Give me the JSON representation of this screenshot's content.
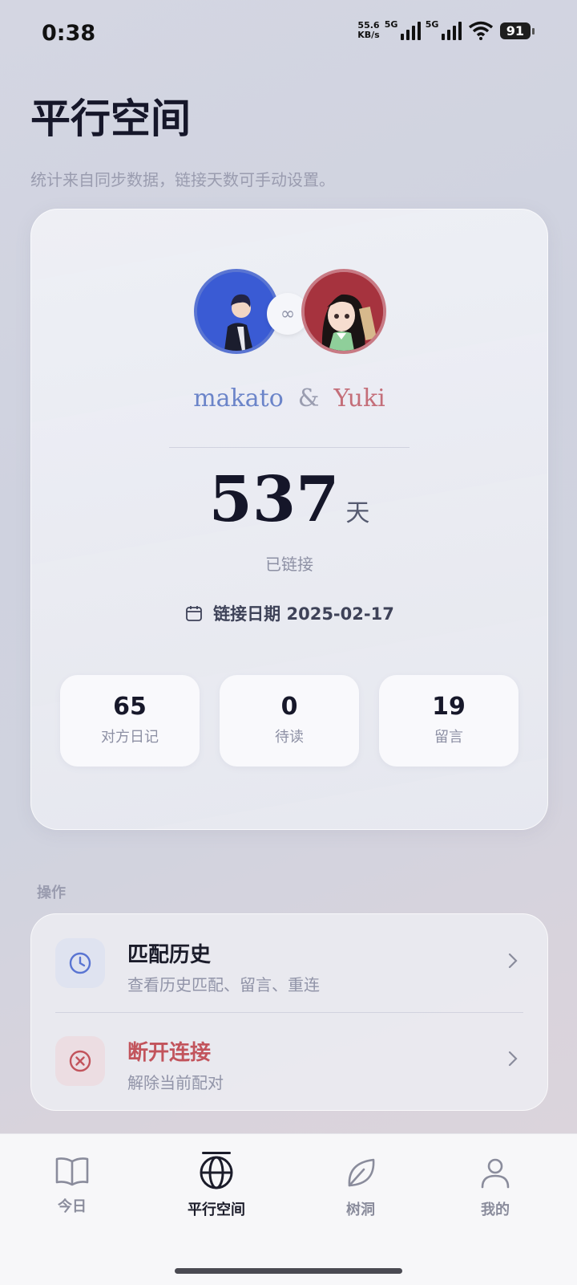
{
  "status_bar": {
    "time": "0:38",
    "net_speed_value": "55.6",
    "net_speed_unit": "KB/s",
    "sim1": "5G",
    "sim2": "5G",
    "battery": "91"
  },
  "page": {
    "title": "平行空间",
    "subtitle": "统计来自同步数据，链接天数可手动设置。"
  },
  "connection": {
    "user_a": "makato",
    "ampersand": "&",
    "user_b": "Yuki",
    "link_symbol": "∞",
    "days": "537",
    "days_unit": "天",
    "linked_label": "已链接",
    "date_label": "链接日期 2025-02-17"
  },
  "stats": [
    {
      "value": "65",
      "label": "对方日记"
    },
    {
      "value": "0",
      "label": "待读"
    },
    {
      "value": "19",
      "label": "留言"
    }
  ],
  "actions": {
    "section_label": "操作",
    "items": [
      {
        "title": "匹配历史",
        "subtitle": "查看历史匹配、留言、重连",
        "icon": "clock-icon",
        "color": "#1b1c2a"
      },
      {
        "title": "断开连接",
        "subtitle": "解除当前配对",
        "icon": "close-circle-icon",
        "color": "#c2545c"
      }
    ]
  },
  "nav": {
    "items": [
      {
        "label": "今日",
        "icon": "book-icon"
      },
      {
        "label": "平行空间",
        "icon": "globe-icon",
        "active": true
      },
      {
        "label": "树洞",
        "icon": "leaf-icon"
      },
      {
        "label": "我的",
        "icon": "person-icon"
      }
    ]
  },
  "colors": {
    "accent_blue": "#5a75d2",
    "accent_pink": "#c87a84",
    "danger": "#c2545c"
  }
}
